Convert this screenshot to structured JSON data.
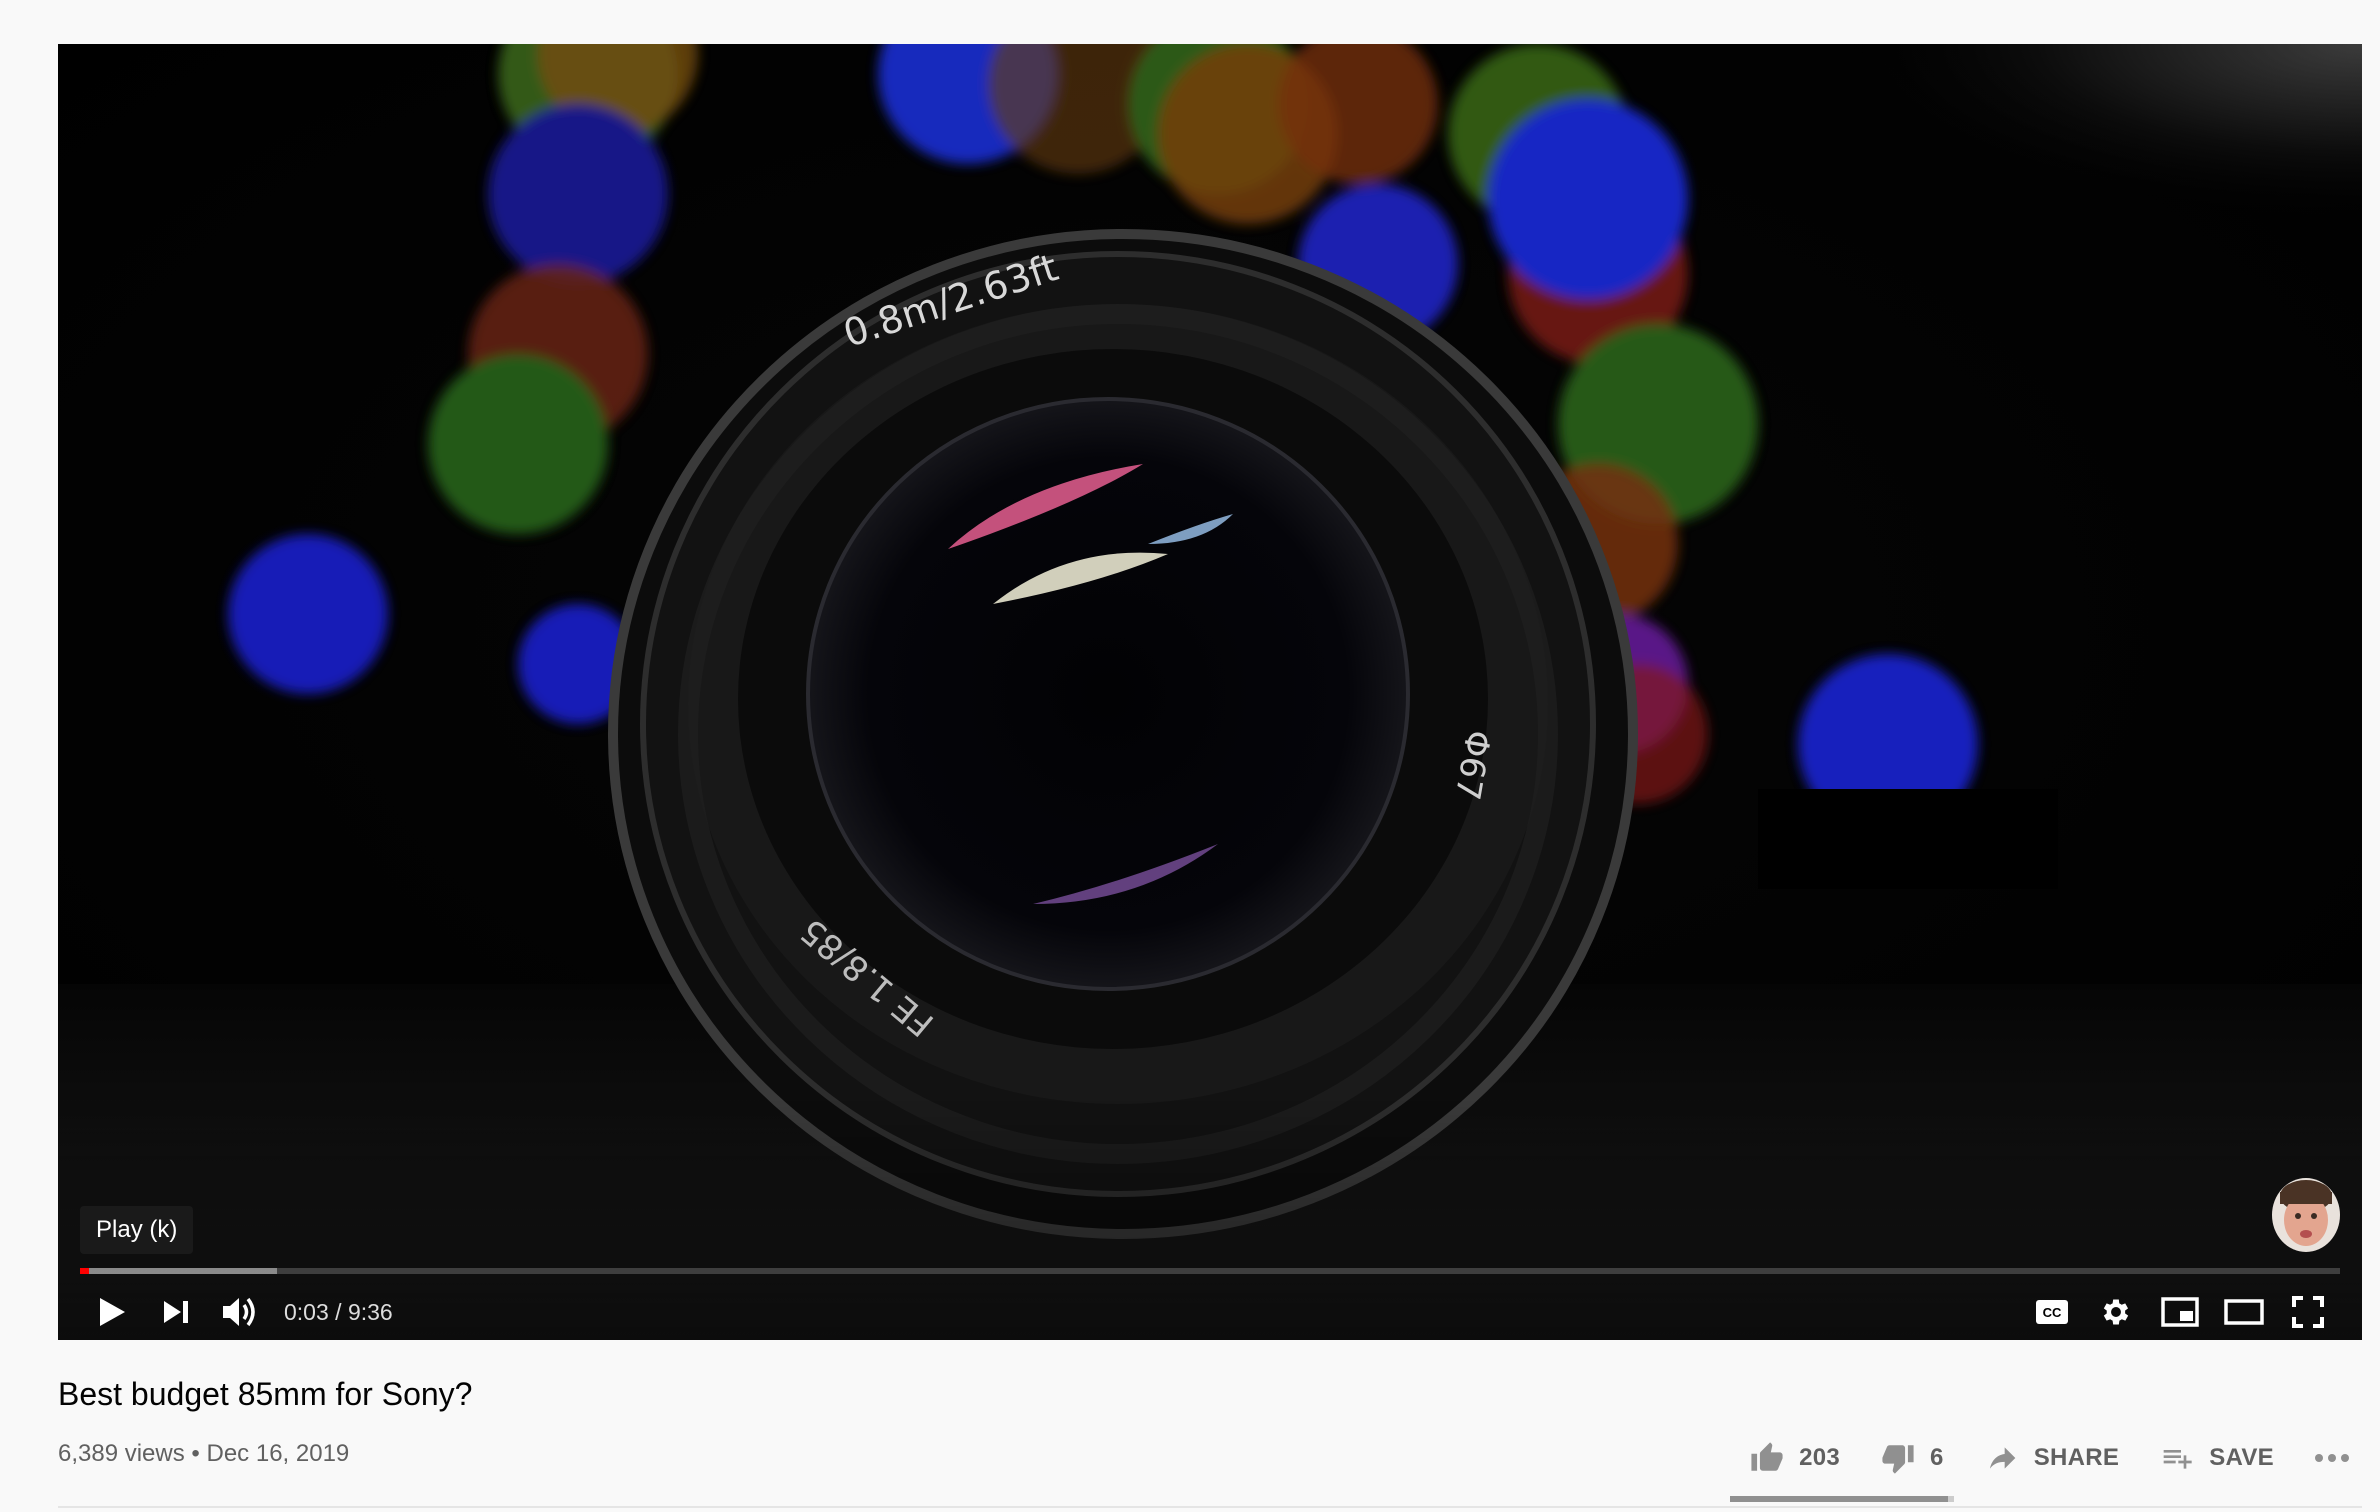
{
  "player": {
    "tooltip": "Play (k)",
    "time_current": "0:03",
    "time_sep": " / ",
    "time_total": "9:36",
    "progress_played_fraction": 0.003,
    "progress_loaded_fraction": 0.087,
    "lens_text": {
      "distance": "0.8m/2.63ft",
      "filter": "Φ67",
      "model": "FE 1.8/85"
    },
    "icons": {
      "play": "play-icon",
      "next": "next-icon",
      "volume": "volume-icon",
      "captions": "cc-icon",
      "settings": "gear-icon",
      "miniplayer": "miniplayer-icon",
      "theater": "theater-mode-icon",
      "fullscreen": "fullscreen-icon"
    }
  },
  "video": {
    "title": "Best budget 85mm for Sony?",
    "views": "6,389 views",
    "dot": " • ",
    "date": "Dec 16, 2019"
  },
  "actions": {
    "like_count": "203",
    "dislike_count": "6",
    "share_label": "SHARE",
    "save_label": "SAVE",
    "like_ratio": 0.971
  },
  "colors": {
    "accent_red": "#ff0000",
    "text_primary": "#030303",
    "text_secondary": "#606060",
    "background": "#f9f9f9"
  }
}
